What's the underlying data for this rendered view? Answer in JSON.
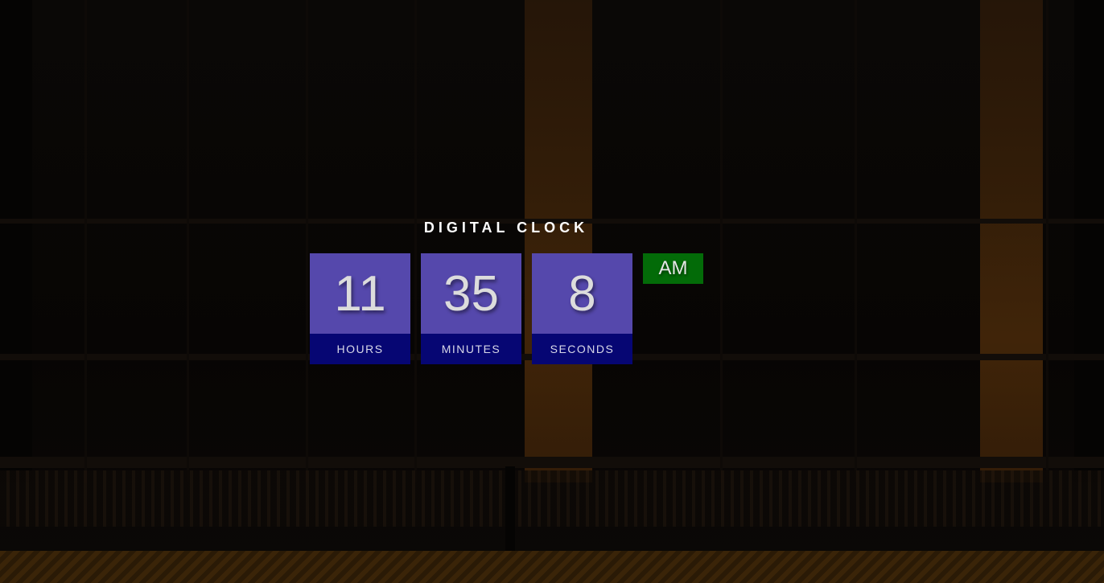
{
  "title": "DIGITAL CLOCK",
  "clock": {
    "hours": {
      "value": "11",
      "label": "HOURS"
    },
    "minutes": {
      "value": "35",
      "label": "MINUTES"
    },
    "seconds": {
      "value": "8",
      "label": "SECONDS"
    },
    "period": "AM"
  },
  "colors": {
    "digit_background": "#5548ac",
    "label_background": "#060673",
    "period_background": "#036b08"
  }
}
